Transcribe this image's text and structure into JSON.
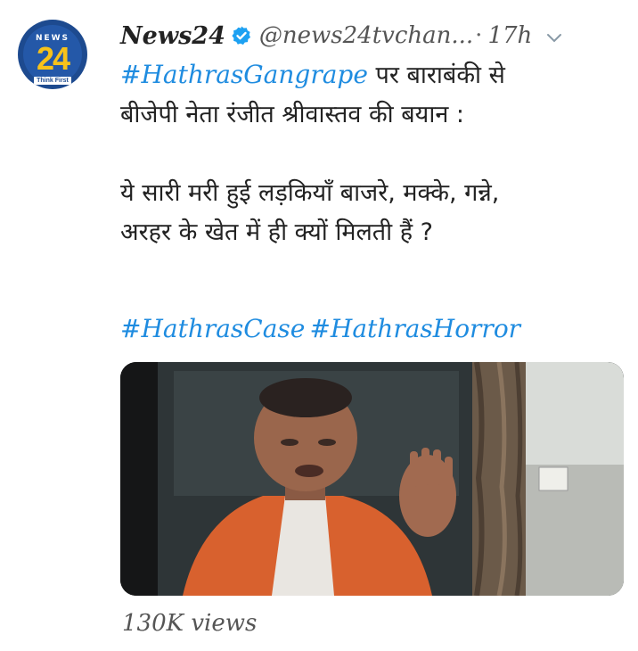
{
  "tweet": {
    "author": {
      "display_name": "News24",
      "handle": "@news24tvchan...",
      "verified": true,
      "avatar": {
        "logo_top": "NEWS",
        "logo_num": "24",
        "logo_tagline": "Think First"
      }
    },
    "time_separator": "·",
    "time": "17h",
    "menu_icon": "chevron-down-icon",
    "body": {
      "hashtag_lead": "#HathrasGangrape",
      "line1_rest": " पर बाराबंकी से",
      "line2": "बीजेपी नेता रंजीत श्रीवास्तव की बयान :",
      "line3": "ये सारी मरी हुई लड़कियाँ बाजरे, मक्के, गन्ने,",
      "line4": "अरहर के खेत में ही क्यों मिलती हैं ?"
    },
    "hashtags": [
      "#HathrasCase",
      "#HathrasHorror"
    ],
    "media": {
      "type": "video-thumbnail"
    },
    "views": "130K views"
  },
  "colors": {
    "link": "#1f8ce0",
    "text": "#222222",
    "muted": "#555555",
    "verified": "#1da1f2",
    "avatar_bg": "#1d4a8f",
    "avatar_num": "#f7c21a"
  }
}
